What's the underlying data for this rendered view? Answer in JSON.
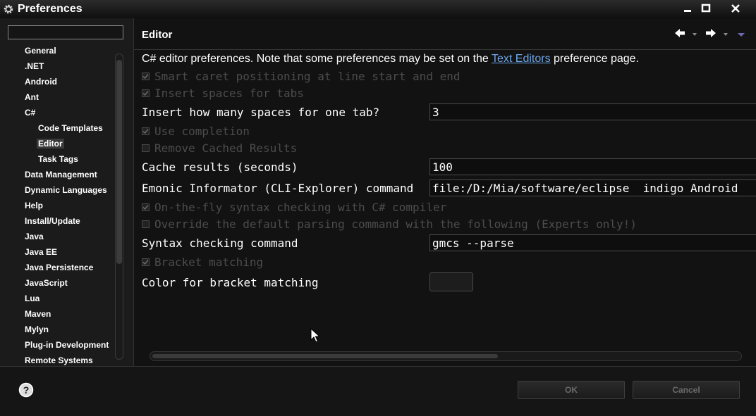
{
  "window": {
    "title": "Preferences"
  },
  "sidebar": {
    "filter_value": "",
    "items": [
      {
        "label": "General"
      },
      {
        "label": ".NET"
      },
      {
        "label": "Android"
      },
      {
        "label": "Ant"
      },
      {
        "label": "C#"
      },
      {
        "label": "Code Templates"
      },
      {
        "label": "Editor"
      },
      {
        "label": "Task Tags"
      },
      {
        "label": "Data Management"
      },
      {
        "label": "Dynamic Languages"
      },
      {
        "label": "Help"
      },
      {
        "label": "Install/Update"
      },
      {
        "label": "Java"
      },
      {
        "label": "Java EE"
      },
      {
        "label": "Java Persistence"
      },
      {
        "label": "JavaScript"
      },
      {
        "label": "Lua"
      },
      {
        "label": "Maven"
      },
      {
        "label": "Mylyn"
      },
      {
        "label": "Plug-in Development"
      },
      {
        "label": "Remote Systems"
      }
    ]
  },
  "editor": {
    "title": "Editor",
    "description_prefix": "C# editor preferences. Note that some preferences may be set on the ",
    "description_link": "Text Editors",
    "description_suffix": " preference page.",
    "options": {
      "smart_caret": {
        "label": "Smart caret positioning at line start and end",
        "checked": true
      },
      "insert_spaces": {
        "label": "Insert spaces for tabs",
        "checked": true
      },
      "use_completion": {
        "label": "Use completion",
        "checked": true
      },
      "remove_cached": {
        "label": "Remove Cached Results",
        "checked": false
      },
      "on_the_fly": {
        "label": "On-the-fly syntax checking with C# compiler",
        "checked": true
      },
      "override_parsing": {
        "label": "Override the default parsing command with the following (Experts only!)",
        "checked": false
      },
      "bracket_matching": {
        "label": "Bracket matching",
        "checked": true
      }
    },
    "fields": {
      "spaces_per_tab": {
        "label": "Insert how many spaces for one tab?",
        "value": "3"
      },
      "cache_results": {
        "label": "Cache results (seconds)",
        "value": "100"
      },
      "emonic_command": {
        "label": "Emonic Informator (CLI-Explorer) command",
        "value": "file:/D:/Mia/software/eclipse  indigo Android"
      },
      "syntax_command": {
        "label": "Syntax checking command",
        "value": "gmcs --parse"
      },
      "bracket_color": {
        "label": "Color for bracket matching"
      }
    }
  },
  "buttons": {
    "ok": "OK",
    "cancel": "Cancel"
  },
  "colors": {
    "link": "#6fa6e6",
    "background": "#121212",
    "disabled_text": "#4c4c4c"
  }
}
